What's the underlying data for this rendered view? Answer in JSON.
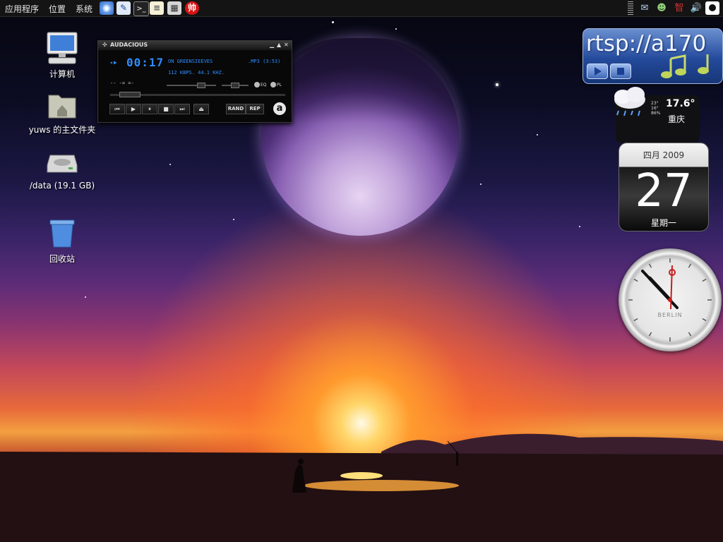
{
  "menubar": {
    "applications": "应用程序",
    "places": "位置",
    "system": "系统",
    "launchers": [
      "globe-icon",
      "text-editor-icon",
      "terminal-icon",
      "notepad-icon",
      "calculator-icon",
      "shuai-icon"
    ],
    "shuai_glyph": "帅",
    "tray": [
      "mail-icon",
      "user-icon",
      "input-method-icon",
      "volume-icon",
      "power-icon"
    ],
    "input_method_glyph": "智"
  },
  "desktop_icons": [
    {
      "label": "计算机",
      "icon": "computer-icon"
    },
    {
      "label": "yuws 的主文件夹",
      "icon": "home-folder-icon"
    },
    {
      "label": "/data (19.1 GB)",
      "icon": "drive-icon"
    },
    {
      "label": "回收站",
      "icon": "trash-icon"
    }
  ],
  "audacious": {
    "title": "AUDACIOUS",
    "time": "00:17",
    "song": "ON GREENSIEEVES",
    "format": ".MP3 (3:53)",
    "bitrate": "112 KBPS. 44.1 KHZ.",
    "eq_label": "EQ",
    "pl_label": "PL",
    "rand_label": "RAND",
    "rep_label": "REP",
    "logo_letter": "a",
    "transport": [
      "⏮",
      "▶",
      "⏸",
      "■",
      "⏭",
      "⏏"
    ]
  },
  "rtsp_widget": {
    "text": "rtsp://a170"
  },
  "weather_widget": {
    "temp": "17.6°",
    "city": "重庆",
    "high": "23°",
    "low": "16°",
    "humidity": "86%"
  },
  "calendar_widget": {
    "month_year": "四月 2009",
    "day": "27",
    "weekday": "星期一"
  },
  "clock_widget": {
    "city": "BERLIN"
  },
  "colors": {
    "lcd_blue": "#2f8cff",
    "topbar": "#141414"
  }
}
